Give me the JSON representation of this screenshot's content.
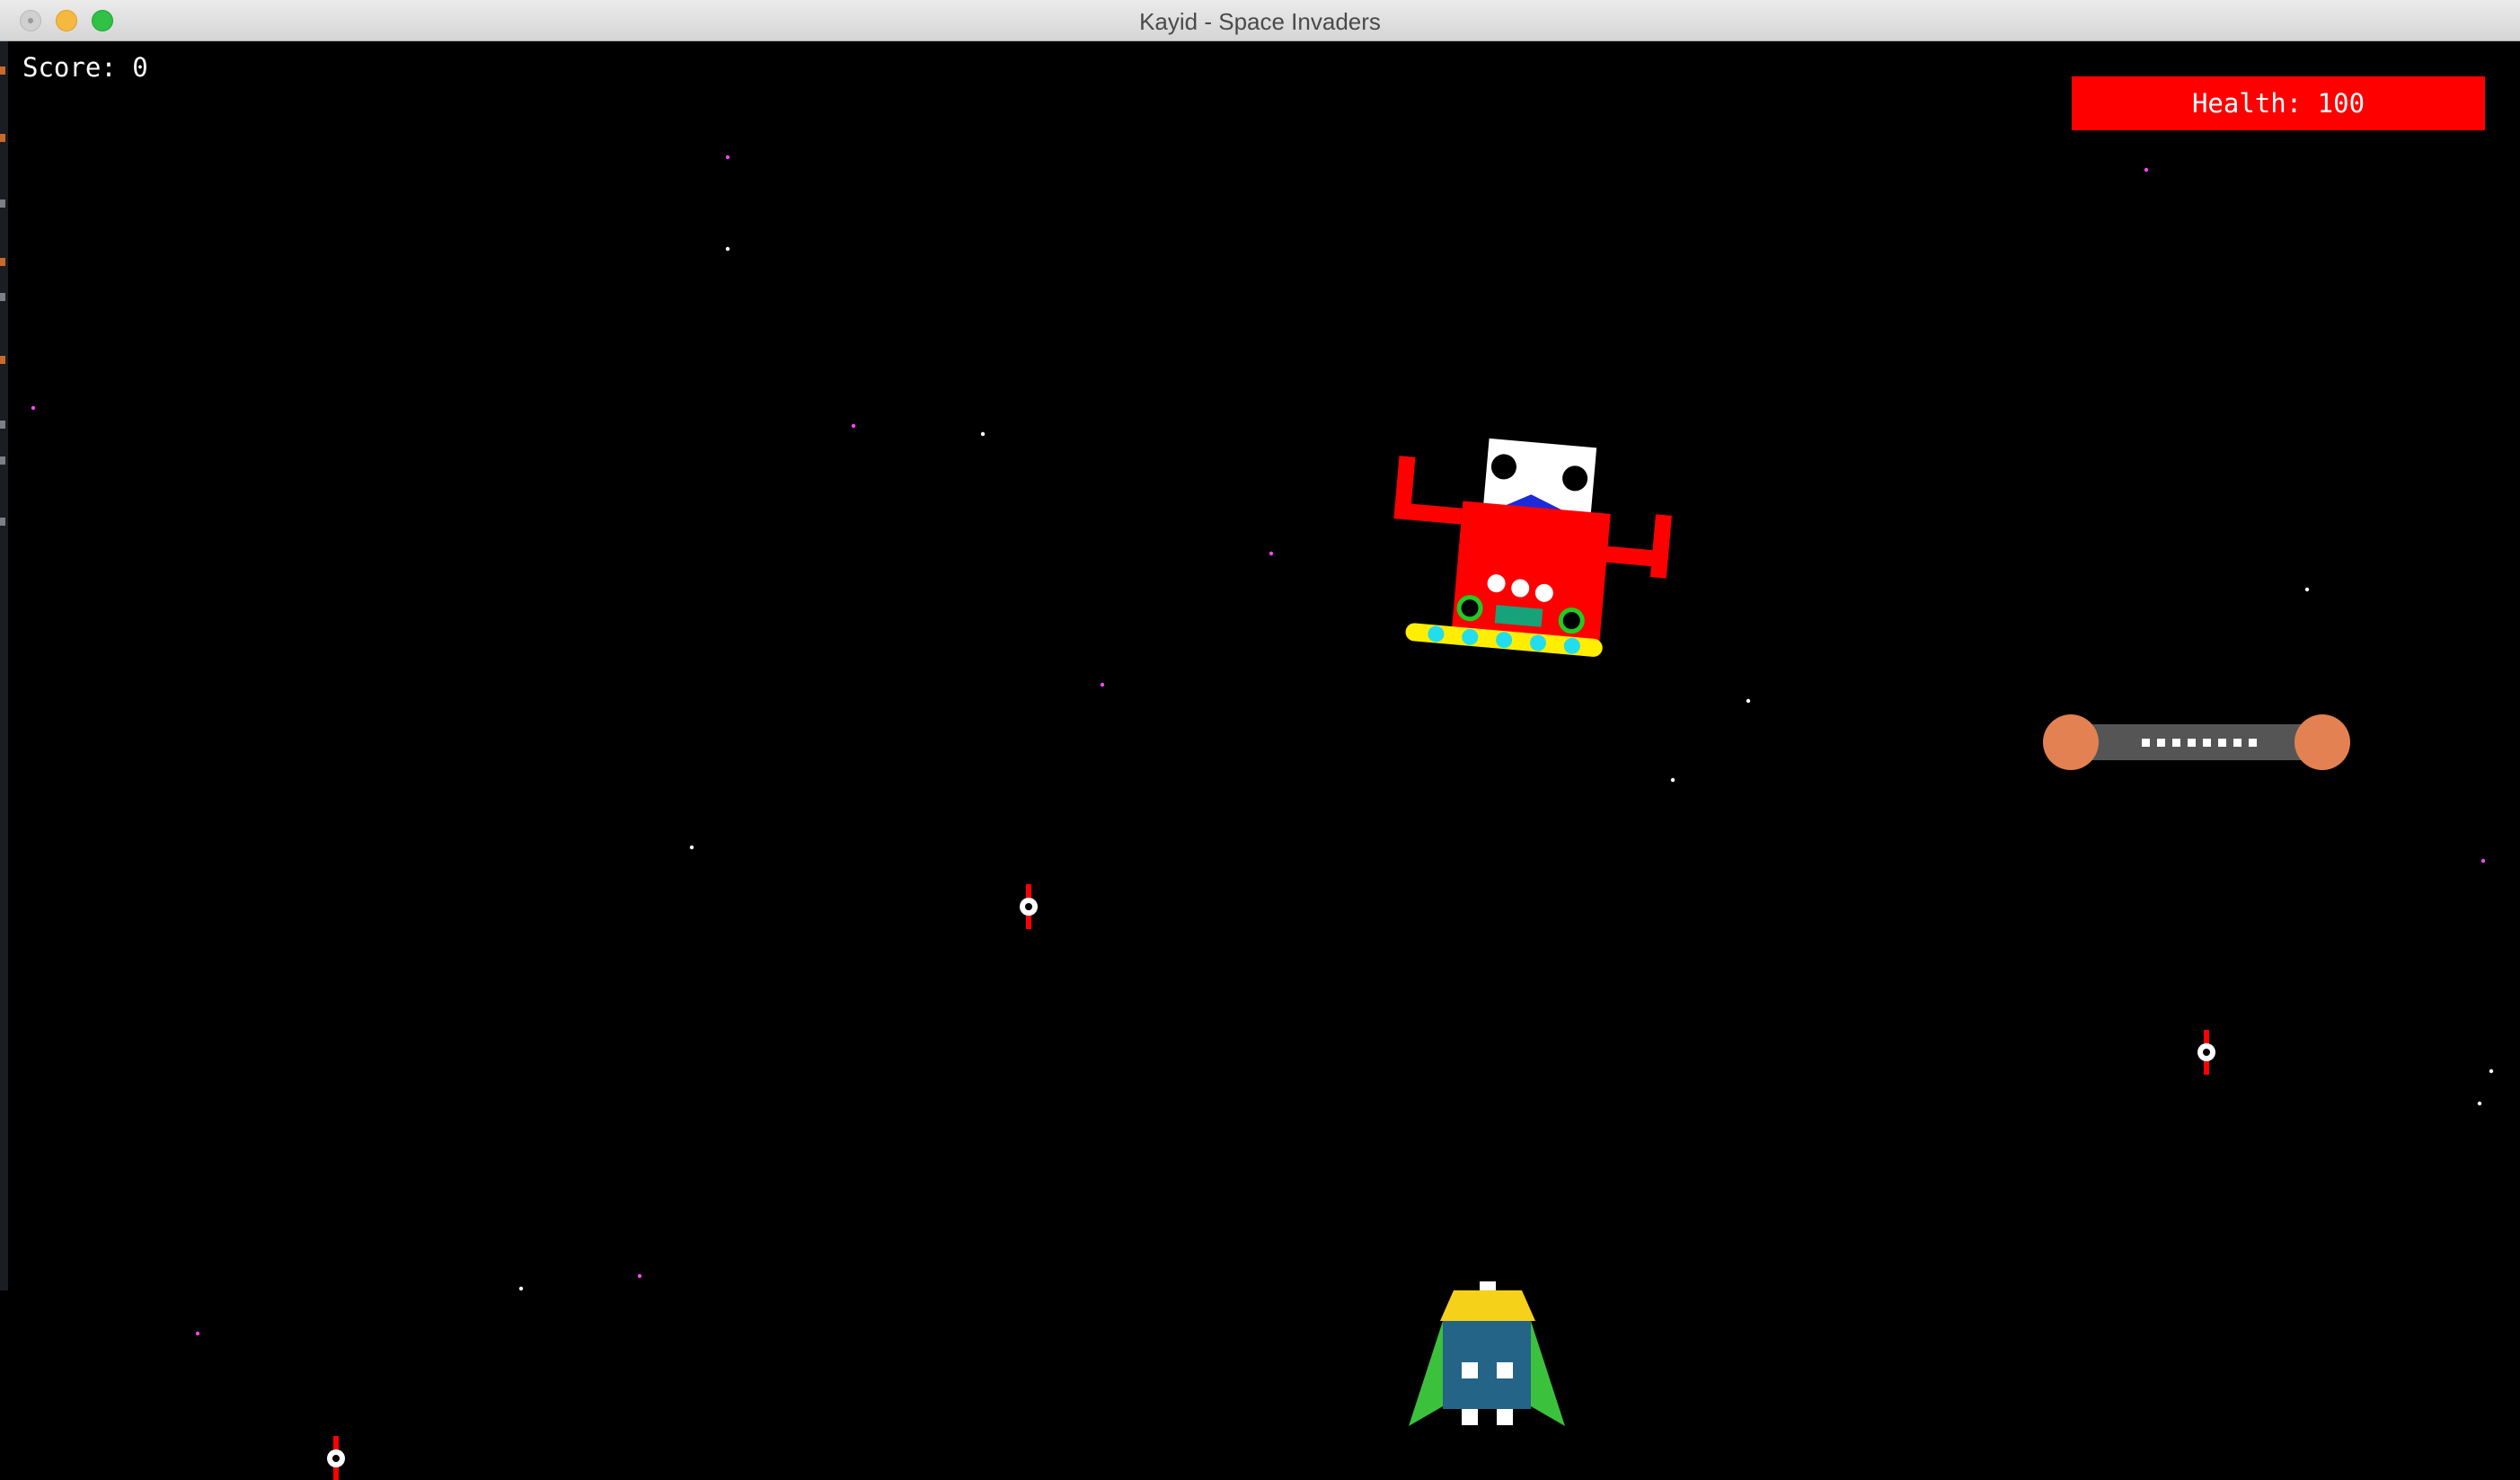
{
  "window": {
    "title": "Kayid - Space Invaders"
  },
  "hud": {
    "score_text": "Score: 0",
    "health_text": "Health: 100",
    "health_value": 100,
    "health_color": "#ff0000"
  },
  "game": {
    "background_color": "#000000",
    "star_colors": [
      "#ff44ff",
      "#ffffff"
    ]
  },
  "colors": {
    "boss_body": "#ff0000",
    "boss_head": "#ffffff",
    "boss_mouth": "#1c2bd9",
    "boss_ring": "#ffee00",
    "boss_ring_lights": "#22ddee",
    "boss_eyes_ring": "#22cc22",
    "boss_panel": "#16a37a",
    "player_body": "#246486",
    "player_top": "#f5d11a",
    "player_wings": "#3cc13c",
    "orb_color": "#e38152",
    "orb_bar": "#555555",
    "bullet_red": "#ff0000"
  },
  "icons": {
    "close": "close-circle-icon",
    "minimize": "minimize-circle-icon",
    "maximize": "maximize-circle-icon"
  }
}
